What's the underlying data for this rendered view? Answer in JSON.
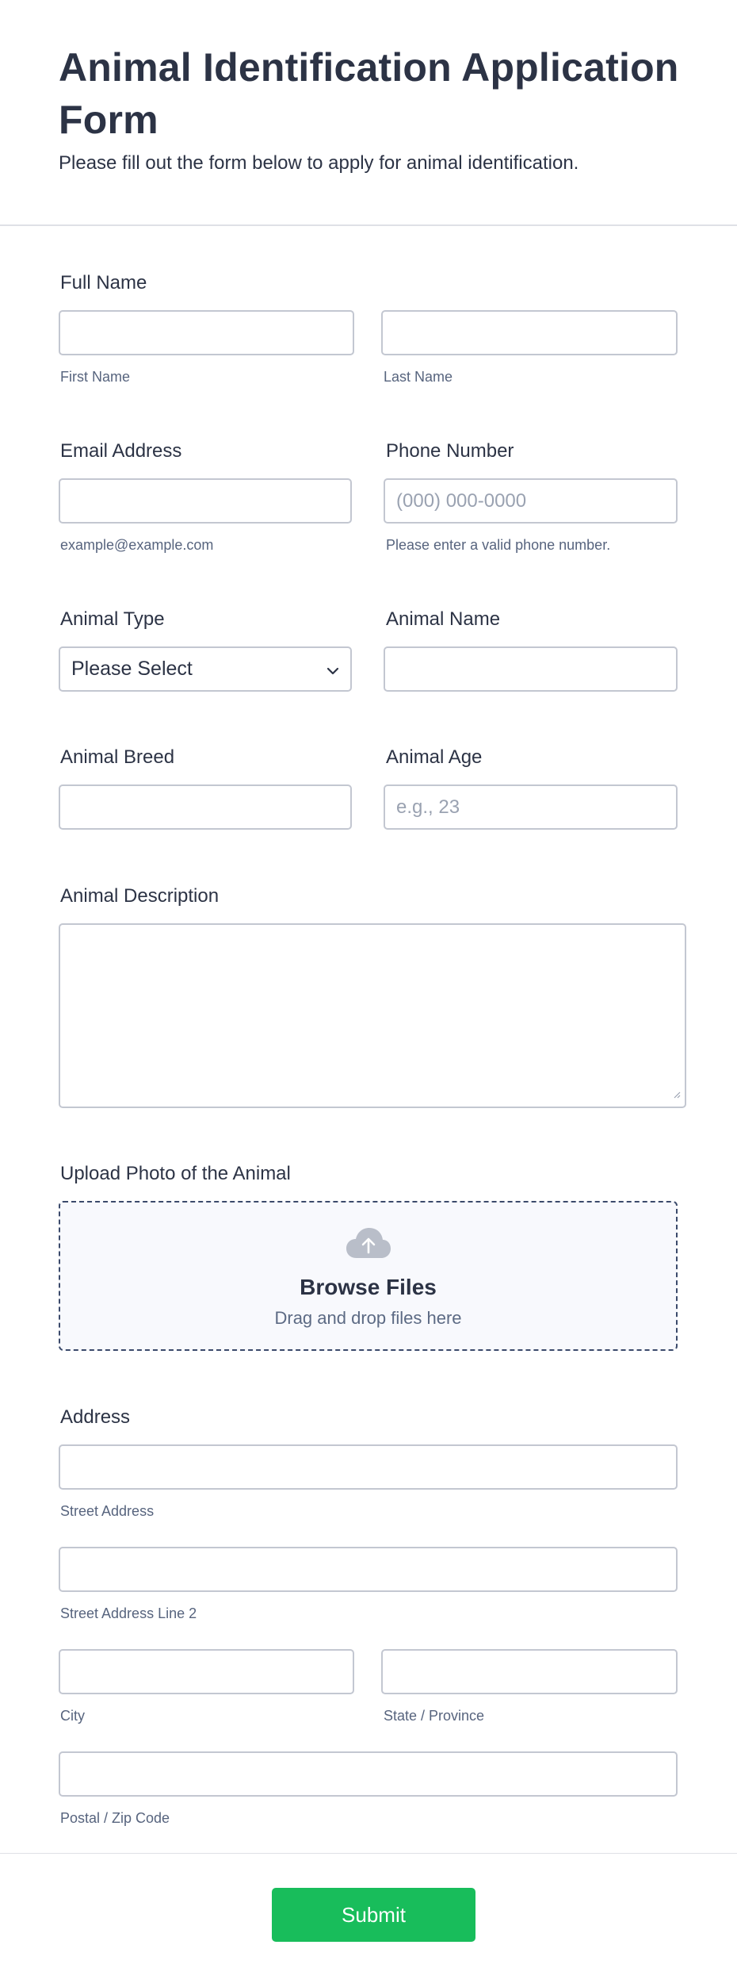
{
  "header": {
    "title": "Animal Identification Application Form",
    "subtitle": "Please fill out the form below to apply for animal identification."
  },
  "full_name": {
    "label": "Full Name",
    "first_sub": "First Name",
    "last_sub": "Last Name",
    "first_value": "",
    "last_value": ""
  },
  "email": {
    "label": "Email Address",
    "sub": "example@example.com",
    "value": ""
  },
  "phone": {
    "label": "Phone Number",
    "placeholder": "(000) 000-0000",
    "sub": "Please enter a valid phone number."
  },
  "animal_type": {
    "label": "Animal Type",
    "selected": "Please Select",
    "chevron_icon": "chevron-down-icon"
  },
  "animal_name": {
    "label": "Animal Name",
    "value": ""
  },
  "animal_breed": {
    "label": "Animal Breed",
    "value": ""
  },
  "animal_age": {
    "label": "Animal Age",
    "placeholder": "e.g., 23"
  },
  "animal_description": {
    "label": "Animal Description",
    "value": ""
  },
  "upload": {
    "label": "Upload Photo of the Animal",
    "icon": "cloud-upload-icon",
    "browse": "Browse Files",
    "drag": "Drag and drop files here"
  },
  "address": {
    "label": "Address",
    "street_sub": "Street Address",
    "street2_sub": "Street Address Line 2",
    "city_sub": "City",
    "state_sub": "State / Province",
    "postal_sub": "Postal / Zip Code"
  },
  "submit": {
    "label": "Submit"
  },
  "colors": {
    "text": "#2c3345",
    "sublabel": "#57647e",
    "border": "#c3c7d1",
    "submit": "#18bd5b",
    "upload_bg": "#f8f9fd"
  }
}
